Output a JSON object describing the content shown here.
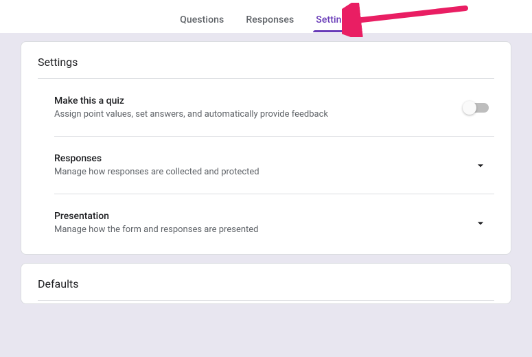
{
  "tabs": {
    "questions": "Questions",
    "responses": "Responses",
    "settings": "Settings"
  },
  "settingsCard": {
    "title": "Settings",
    "quiz": {
      "title": "Make this a quiz",
      "desc": "Assign point values, set answers, and automatically provide feedback",
      "enabled": false
    },
    "responses": {
      "title": "Responses",
      "desc": "Manage how responses are collected and protected"
    },
    "presentation": {
      "title": "Presentation",
      "desc": "Manage how the form and responses are presented"
    }
  },
  "defaultsCard": {
    "title": "Defaults"
  }
}
